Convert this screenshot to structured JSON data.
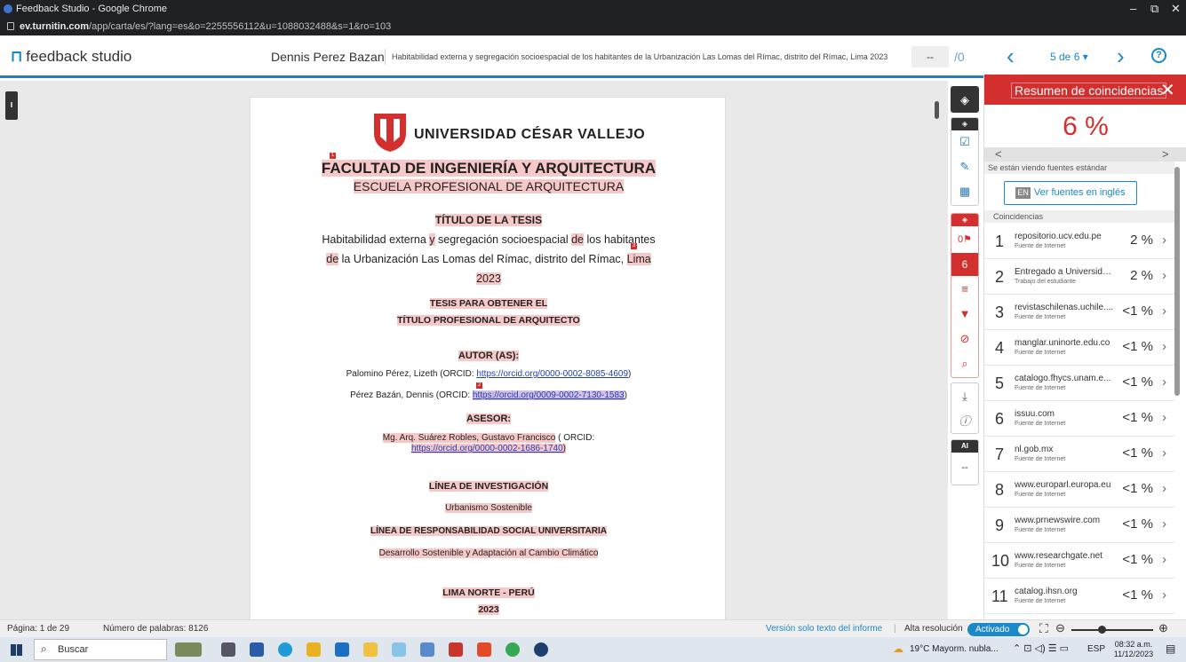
{
  "browser": {
    "window_title": "Feedback Studio - Google Chrome",
    "url_host": "ev.turnitin.com",
    "url_path": "/app/carta/es/?lang=es&o=2255556112&u=1088032488&s=1&ro=103",
    "minimize": "–",
    "restore": "⧉",
    "close": "✕"
  },
  "header": {
    "logo_text": "feedback studio",
    "author": "Dennis Perez Bazan",
    "doc_title": "Habitabilidad externa y segregación socioespacial de los habitantes de la Urbanización Las Lomas del Rímac, distrito del Rímac, Lima 2023",
    "grade_value": "--",
    "grade_out_of": "/0",
    "prev": "‹",
    "next": "›",
    "pager": "5 de 6 ▾",
    "help": "?"
  },
  "document": {
    "university": "UNIVERSIDAD CÉSAR VALLEJO",
    "faculty": "FACULTAD DE INGENIERÍA Y ARQUITECTURA",
    "school": "ESCUELA PROFESIONAL DE ARQUITECTURA",
    "thesis_title_heading": "TÍTULO DE LA TESIS",
    "title_line1_a": "Habitabilidad externa ",
    "title_line1_b": "y",
    "title_line1_c": " segregación socioespacial ",
    "title_line1_d": "de",
    "title_line1_e": " los habitantes",
    "title_line2_a": "de",
    "title_line2_b": " la Urbanización Las Lomas del Rímac, distrito del Rímac, ",
    "title_line2_c": "Lima",
    "title_line3": "2023",
    "thesis_for": "TESIS PARA OBTENER EL",
    "professional_title": "TÍTULO PROFESIONAL DE ARQUITECTO",
    "authors_heading": "AUTOR (AS):",
    "author1_text": "Palomino Pérez, Lizeth (ORCID: ",
    "author1_link": "https://orcid.org/0000-0002-8085-4609",
    "author1_end": ")",
    "author2_text": "Pérez Bazán, Dennis (ORCID: ",
    "author2_link": "https://orcid.org/0009-0002-7130-1583",
    "author2_end": ")",
    "advisor_heading": "ASESOR:",
    "advisor_name": "Mg. Arq. Suárez Robles, Gustavo Francisco",
    "advisor_orcid": " ( ORCID:",
    "advisor_link": "https://orcid.org/0000-0002-1686-1740",
    "advisor_end": ")",
    "research_line_heading": "LÍNEA DE INVESTIGACIÓN",
    "research_line": "Urbanismo Sostenible",
    "social_line_heading": "LÍNEA DE RESPONSABILIDAD SOCIAL UNIVERSITARIA",
    "social_line": "Desarrollo Sostenible y Adaptación al Cambio Climático",
    "place": "LIMA NORTE - PERÚ",
    "year": "2023",
    "marker1": "1",
    "marker2": "2",
    "marker3": "3"
  },
  "toolbar": {
    "ai_label": "AI",
    "ai_value": "--",
    "flags_count": "0",
    "match_count": "6"
  },
  "panel": {
    "title": "Resumen de coincidencias",
    "close": "✕",
    "percentage": "6 %",
    "nav_prev": "<",
    "nav_next": ">",
    "standard_note": "Se están viendo fuentes estándar",
    "english_badge": "EN",
    "english_label": "Ver fuentes en inglés",
    "matches_label": "Coincidencias",
    "rows": [
      {
        "num": "1",
        "name": "repositorio.ucv.edu.pe",
        "type": "Fuente de Internet",
        "pct": "2 %"
      },
      {
        "num": "2",
        "name": "Entregado a Universida...",
        "type": "Trabajo del estudiante",
        "pct": "2 %"
      },
      {
        "num": "3",
        "name": "revistaschilenas.uchile....",
        "type": "Fuente de Internet",
        "pct": "<1 %"
      },
      {
        "num": "4",
        "name": "manglar.uninorte.edu.co",
        "type": "Fuente de Internet",
        "pct": "<1 %"
      },
      {
        "num": "5",
        "name": "catalogo.fhycs.unam.e...",
        "type": "Fuente de Internet",
        "pct": "<1 %"
      },
      {
        "num": "6",
        "name": "issuu.com",
        "type": "Fuente de Internet",
        "pct": "<1 %"
      },
      {
        "num": "7",
        "name": "nl.gob.mx",
        "type": "Fuente de Internet",
        "pct": "<1 %"
      },
      {
        "num": "8",
        "name": "www.europarl.europa.eu",
        "type": "Fuente de Internet",
        "pct": "<1 %"
      },
      {
        "num": "9",
        "name": "www.prnewswire.com",
        "type": "Fuente de Internet",
        "pct": "<1 %"
      },
      {
        "num": "10",
        "name": "www.researchgate.net",
        "type": "Fuente de Internet",
        "pct": "<1 %"
      },
      {
        "num": "11",
        "name": "catalog.ihsn.org",
        "type": "Fuente de Internet",
        "pct": "<1 %"
      }
    ]
  },
  "status": {
    "page": "Página: 1 de 29",
    "words": "Número de palabras: 8126",
    "text_only": "Versión solo texto del informe",
    "sep": "|",
    "hires": "Alta resolución",
    "toggle": "Activado"
  },
  "taskbar": {
    "search": "Buscar",
    "weather": "19°C  Mayorm. nubla...",
    "lang": "ESP",
    "time": "08:32 a.m.",
    "date": "11/12/2023"
  },
  "colors": {
    "accent": "#1a88c9",
    "match_red": "#d32f2f",
    "highlight": "#f7c8c8"
  }
}
